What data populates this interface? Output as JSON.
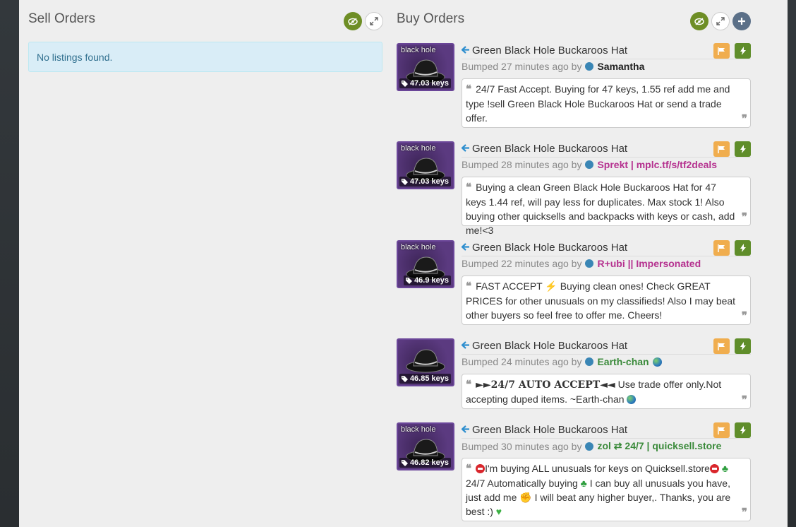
{
  "sell": {
    "title": "Sell Orders",
    "empty_text": "No listings found."
  },
  "buy": {
    "title": "Buy Orders"
  },
  "colors": {
    "toggle_green": "#6e8e25",
    "add_blue": "#5b7088",
    "report_orange": "#f0ad4e",
    "trade_green": "#5f8d2a",
    "unusual_border": "#6a4598",
    "link_blue": "#3a86b5"
  },
  "icons": {
    "visibility": "eye-slash-icon",
    "expand": "expand-icon",
    "add": "plus-icon",
    "report": "flag-icon",
    "trade": "bolt-icon",
    "back": "arrow-left-icon",
    "price": "tag-icon"
  },
  "listings": [
    {
      "effect": "black hole",
      "price": "47.03 keys",
      "item_name": "Green Black Hole Buckaroos Hat",
      "bumped": "Bumped 27 minutes ago by",
      "user": "Samantha",
      "user_color": "#222222",
      "comment": "24/7 Fast Accept. Buying for 47 keys, 1.55 ref add me and type !sell Green Black Hole Buckaroos Hat or send a trade offer."
    },
    {
      "effect": "black hole",
      "price": "47.03 keys",
      "item_name": "Green Black Hole Buckaroos Hat",
      "bumped": "Bumped 28 minutes ago by",
      "user": "Sprekt | mplc.tf/s/tf2deals",
      "user_color": "#b5318f",
      "comment": "Buying a clean Green Black Hole Buckaroos Hat for 47 keys 1.44 ref, will pay less for duplicates. Max stock 1! Also buying other quicksells and backpacks with keys or cash, add me!<3"
    },
    {
      "effect": "black hole",
      "price": "46.9 keys",
      "item_name": "Green Black Hole Buckaroos Hat",
      "bumped": "Bumped 22 minutes ago by",
      "user": "R+ubi || Impersonated",
      "user_color": "#b5318f",
      "comment_a": "FAST ACCEPT",
      "comment_b": "Buying clean ones! Check GREAT PRICES for other unusuals on my classifieds! Also I may beat other buyers so feel free to offer me. Cheers!"
    },
    {
      "effect": "",
      "price": "46.85 keys",
      "item_name": "Green Black Hole Buckaroos Hat",
      "bumped": "Bumped 24 minutes ago by",
      "user": "Earth-chan",
      "user_color": "#3a8a3a",
      "comment_bold": "►►24/7 AUTO ACCEPT◄◄",
      "comment_a": "Use trade offer only.Not accepting duped items. ~Earth-chan"
    },
    {
      "effect": "black hole",
      "price": "46.82 keys",
      "item_name": "Green Black Hole Buckaroos Hat",
      "bumped": "Bumped 30 minutes ago by",
      "user": "zol ⇄ 24/7 | quicksell.store",
      "user_color": "#3a8a3a",
      "comment_a": "I'm buying ALL unusuals for keys on Quicksell.store",
      "comment_b": "24/7 Automatically buying",
      "comment_c": "I can buy all unusuals you have, just add me",
      "comment_d": "I will beat any higher buyer,. Thanks, you are best :)"
    }
  ]
}
